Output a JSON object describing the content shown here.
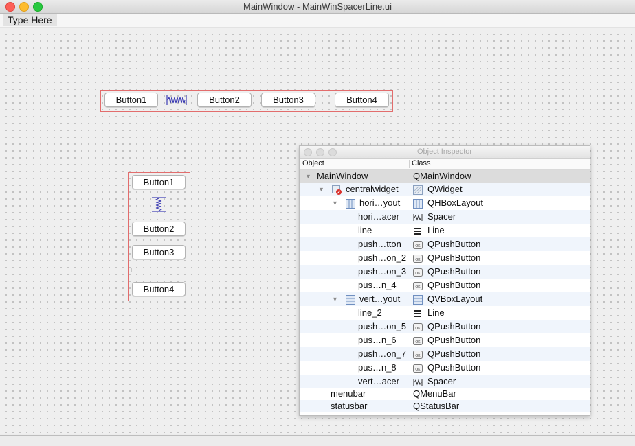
{
  "window": {
    "title": "MainWindow - MainWinSpacerLine.ui"
  },
  "menubar": {
    "item": "Type Here"
  },
  "horizontal_layout": {
    "buttons": [
      "Button1",
      "Button2",
      "Button3",
      "Button4"
    ]
  },
  "vertical_layout": {
    "buttons": [
      "Button1",
      "Button2",
      "Button3",
      "Button4"
    ]
  },
  "inspector": {
    "title": "Object Inspector",
    "col_object": "Object",
    "col_class": "Class",
    "rows": [
      {
        "object": "MainWindow",
        "class": "QMainWindow",
        "icon": "none",
        "class_icon": "none"
      },
      {
        "object": "centralwidget",
        "class": "QWidget",
        "icon": "widget-broken-icon",
        "class_icon": "widget-icon"
      },
      {
        "object": "hori…yout",
        "class": "QHBoxLayout",
        "icon": "hbox-layout-icon",
        "class_icon": "hbox-layout-icon"
      },
      {
        "object": "hori…acer",
        "class": "Spacer",
        "icon": "none",
        "class_icon": "spacer-icon"
      },
      {
        "object": "line",
        "class": "Line",
        "icon": "none",
        "class_icon": "line-icon"
      },
      {
        "object": "push…tton",
        "class": "QPushButton",
        "icon": "none",
        "class_icon": "pushbutton-icon"
      },
      {
        "object": "push…on_2",
        "class": "QPushButton",
        "icon": "none",
        "class_icon": "pushbutton-icon"
      },
      {
        "object": "push…on_3",
        "class": "QPushButton",
        "icon": "none",
        "class_icon": "pushbutton-icon"
      },
      {
        "object": "pus…n_4",
        "class": "QPushButton",
        "icon": "none",
        "class_icon": "pushbutton-icon"
      },
      {
        "object": "vert…yout",
        "class": "QVBoxLayout",
        "icon": "vbox-layout-icon",
        "class_icon": "vbox-layout-icon"
      },
      {
        "object": "line_2",
        "class": "Line",
        "icon": "none",
        "class_icon": "line-icon"
      },
      {
        "object": "push…on_5",
        "class": "QPushButton",
        "icon": "none",
        "class_icon": "pushbutton-icon"
      },
      {
        "object": "pus…n_6",
        "class": "QPushButton",
        "icon": "none",
        "class_icon": "pushbutton-icon"
      },
      {
        "object": "push…on_7",
        "class": "QPushButton",
        "icon": "none",
        "class_icon": "pushbutton-icon"
      },
      {
        "object": "pus…n_8",
        "class": "QPushButton",
        "icon": "none",
        "class_icon": "pushbutton-icon"
      },
      {
        "object": "vert…acer",
        "class": "Spacer",
        "icon": "none",
        "class_icon": "spacer-icon"
      },
      {
        "object": "menubar",
        "class": "QMenuBar",
        "icon": "none",
        "class_icon": "none"
      },
      {
        "object": "statusbar",
        "class": "QStatusBar",
        "icon": "none",
        "class_icon": "none"
      }
    ]
  },
  "colors": {
    "layout_border": "#e26d6d",
    "spacer": "#1a1aa8",
    "selected_row": "#dcdcdc",
    "alt_row": "#f0f5fc"
  }
}
